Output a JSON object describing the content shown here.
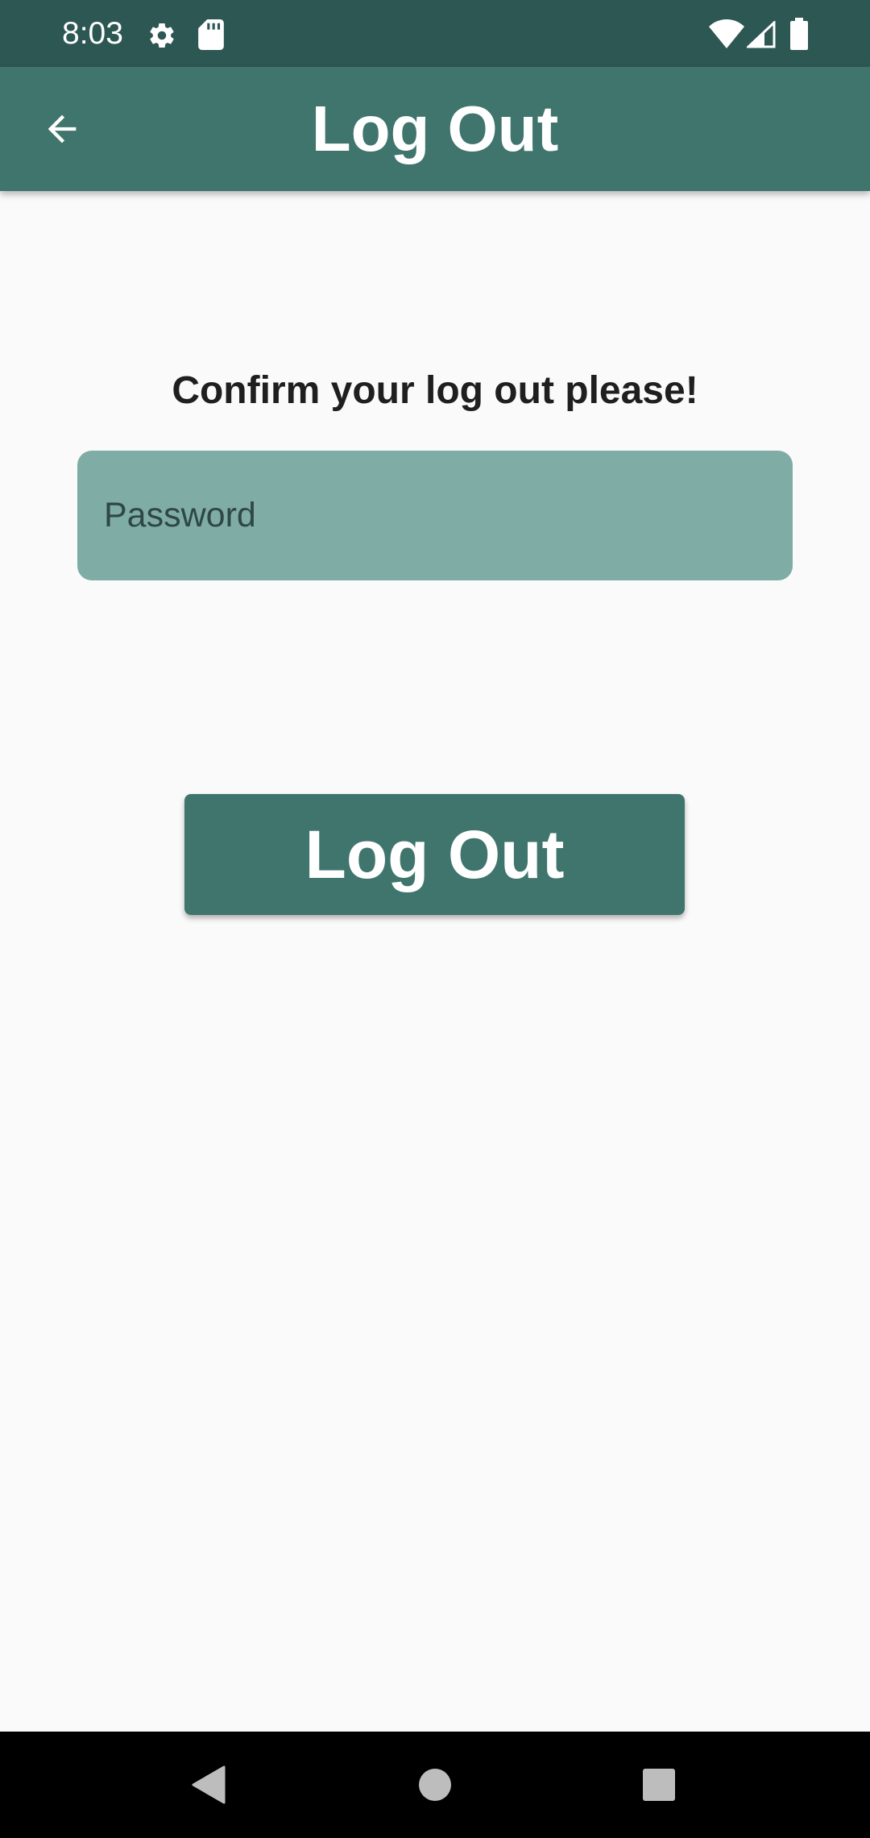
{
  "status_bar": {
    "time": "8:03",
    "icons": [
      "gear-icon",
      "sd-card-icon",
      "wifi-icon",
      "cell-signal-icon",
      "battery-icon"
    ]
  },
  "app_bar": {
    "title": "Log Out",
    "back_icon": "arrow-back-icon"
  },
  "main": {
    "prompt": "Confirm your log out please!",
    "password": {
      "value": "",
      "placeholder": "Password"
    },
    "logout_button_label": "Log Out"
  },
  "nav_bar": {
    "icons": [
      "back-triangle-icon",
      "home-circle-icon",
      "recents-square-icon"
    ]
  },
  "colors": {
    "status_bar": "#2d5753",
    "primary": "#3f756d",
    "field_fill": "#7fada6",
    "background": "#fafafa"
  }
}
